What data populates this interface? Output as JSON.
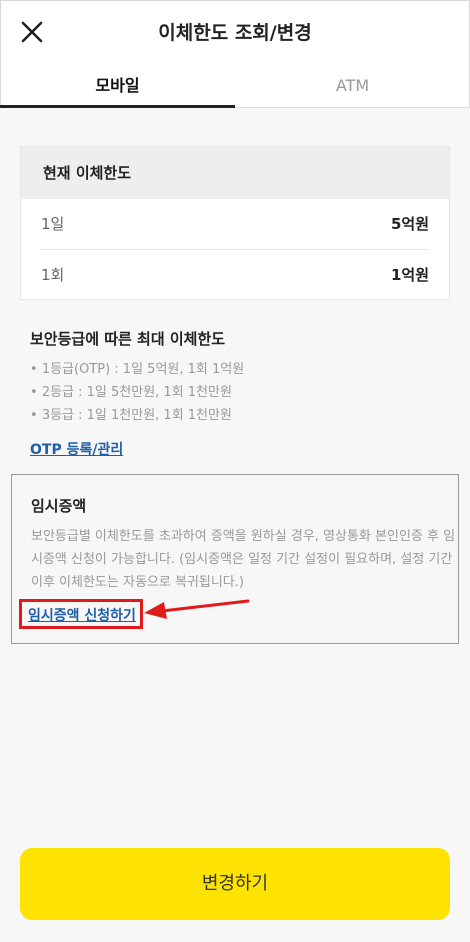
{
  "header": {
    "title": "이체한도 조회/변경",
    "close_icon": "close-icon"
  },
  "tabs": [
    {
      "label": "모바일",
      "active": true
    },
    {
      "label": "ATM",
      "active": false
    }
  ],
  "current_limit": {
    "heading": "현재 이체한도",
    "rows": [
      {
        "label": "1일",
        "value": "5억원"
      },
      {
        "label": "1회",
        "value": "1억원"
      }
    ]
  },
  "security_limits": {
    "title": "보안등급에 따른 최대 이체한도",
    "items": [
      "1등급(OTP) : 1일 5억원, 1회 1억원",
      "2등급 : 1일 5천만원, 1회 1천만원",
      "3등급 : 1일 1천만원, 1회 1천만원"
    ],
    "otp_link": "OTP 등록/관리"
  },
  "temporary_increase": {
    "title": "임시증액",
    "description": "보안등급별 이체한도를 초과하여 증액을 원하실 경우, 영상통화 본인인증 후 임시증액 신청이 가능합니다. (임시증액은 일정 기간 설정이 필요하며, 설정 기간 이후 이체한도는 자동으로 복귀됩니다.)",
    "link": "임시증액 신청하기"
  },
  "footer": {
    "change_button": "변경하기"
  },
  "colors": {
    "accent_yellow": "#ffe300",
    "link_blue": "#1e5fa8",
    "highlight_red": "#e11b1b"
  }
}
